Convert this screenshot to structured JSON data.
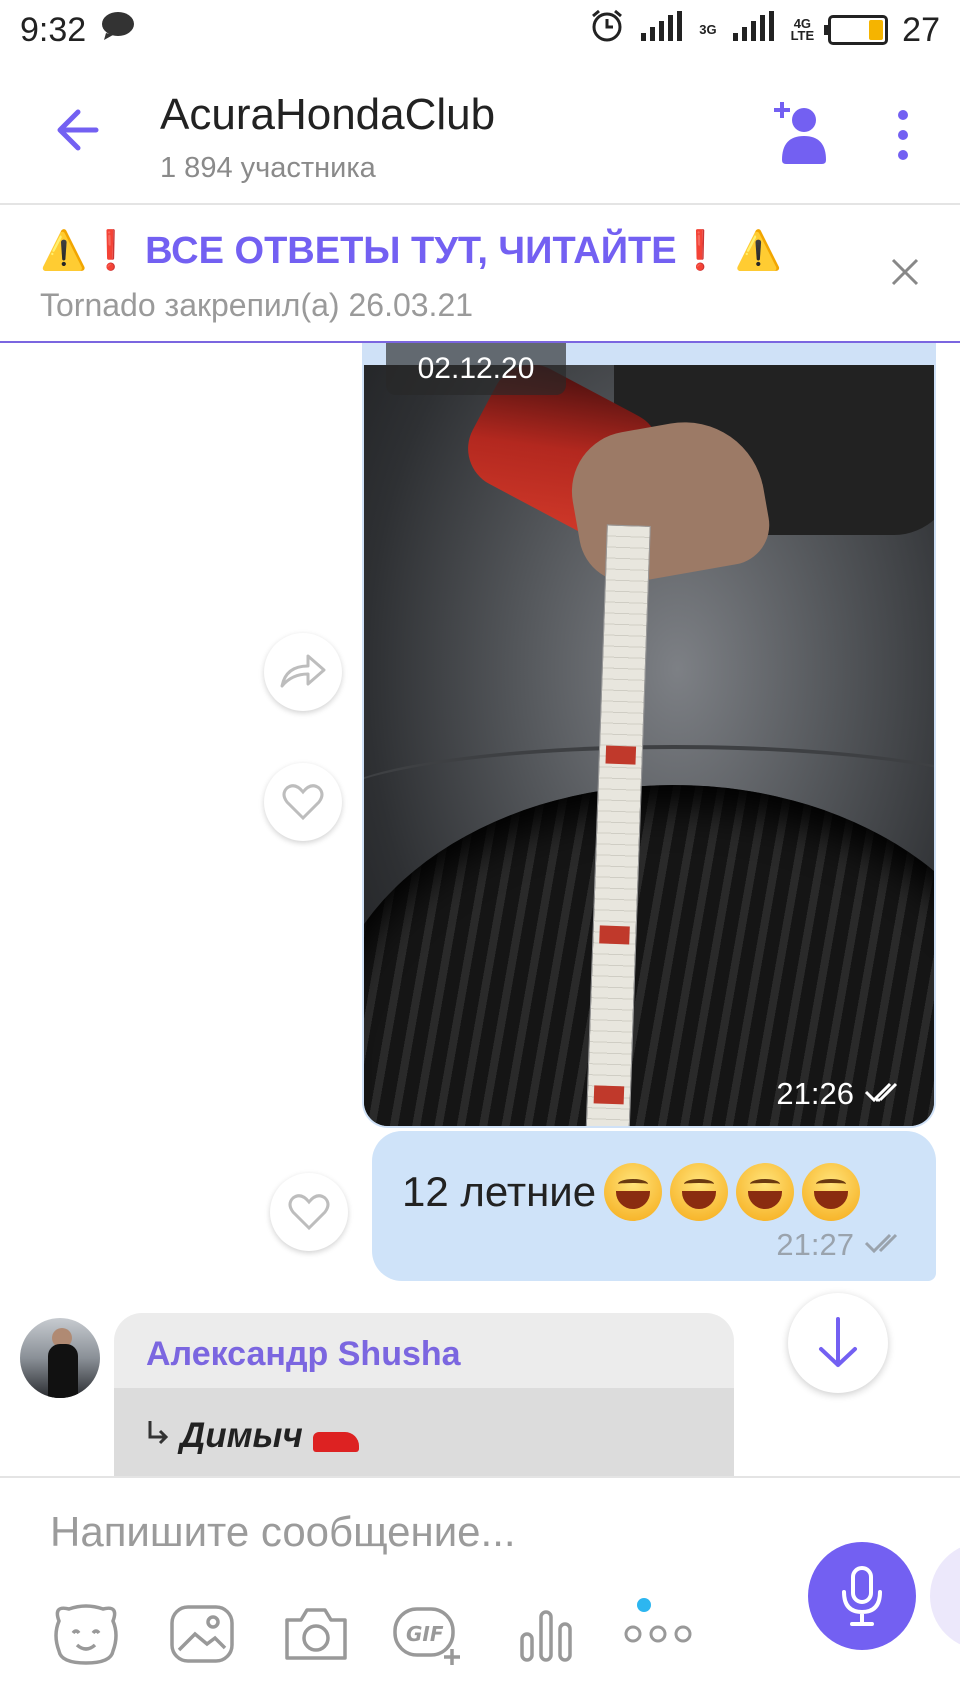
{
  "status_bar": {
    "time": "9:32",
    "net1": "3G",
    "net2_top": "4G",
    "net2_bottom": "LTE",
    "battery": "27"
  },
  "header": {
    "title": "AcuraHondaClub",
    "subtitle": "1 894 участника"
  },
  "pinned": {
    "text": "⚠️❗ ВСЕ ОТВЕТЫ ТУТ, ЧИТАЙТЕ❗ ⚠️",
    "meta": "Tornado закрепил(а) 26.03.21"
  },
  "messages": {
    "date_label": "02.12.20",
    "photo_time": "21:26",
    "text_message": "12 летние",
    "text_time": "21:27",
    "incoming_author": "Александр Shusha",
    "reply_to": "Димыч"
  },
  "composer": {
    "placeholder": "Напишите сообщение..."
  },
  "colors": {
    "accent": "#7360f2",
    "outgoing_bubble": "#cfe3f9",
    "incoming_bubble": "#ececec"
  }
}
